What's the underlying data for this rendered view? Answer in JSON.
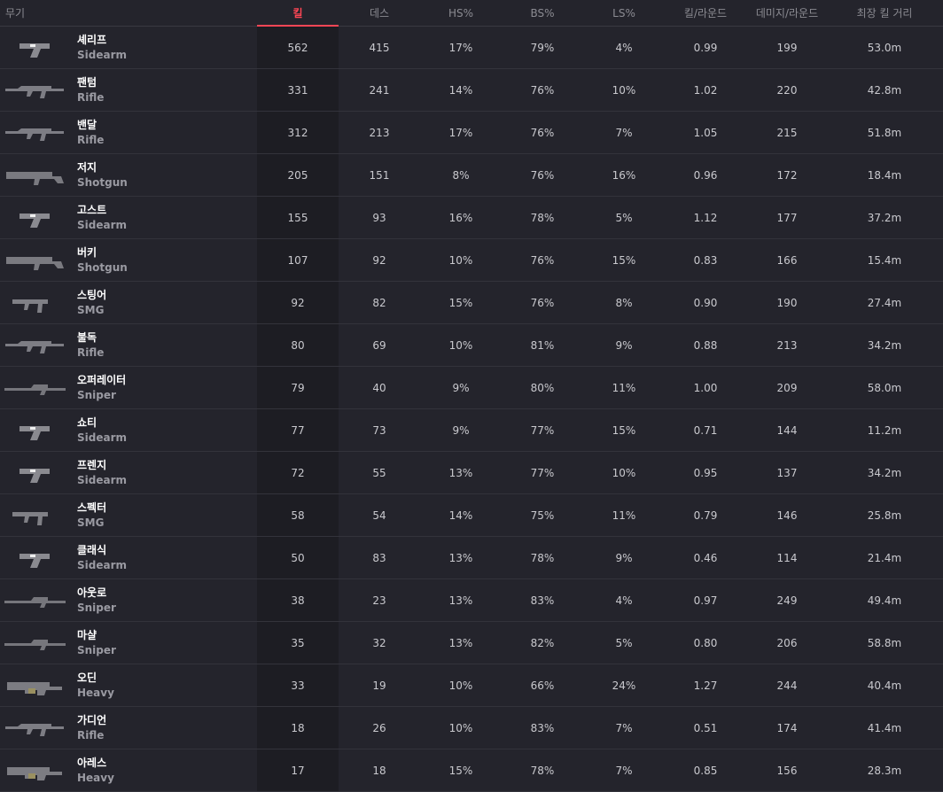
{
  "headers": {
    "weapon": "무기",
    "kills": "킬",
    "deaths": "데스",
    "hs": "HS%",
    "bs": "BS%",
    "ls": "LS%",
    "kpr": "킬/라운드",
    "dpr": "데미지/라운드",
    "longest": "최장 킬 거리"
  },
  "colors": {
    "accent": "#ff4655",
    "background": "#24242c",
    "sorted_column": "#1d1d23"
  },
  "rows": [
    {
      "icon": "sheriff-icon",
      "name": "셰리프",
      "type": "Sidearm",
      "kills": "562",
      "deaths": "415",
      "hs": "17%",
      "bs": "79%",
      "ls": "4%",
      "kpr": "0.99",
      "dpr": "199",
      "longest": "53.0m"
    },
    {
      "icon": "phantom-icon",
      "name": "팬텀",
      "type": "Rifle",
      "kills": "331",
      "deaths": "241",
      "hs": "14%",
      "bs": "76%",
      "ls": "10%",
      "kpr": "1.02",
      "dpr": "220",
      "longest": "42.8m"
    },
    {
      "icon": "vandal-icon",
      "name": "밴달",
      "type": "Rifle",
      "kills": "312",
      "deaths": "213",
      "hs": "17%",
      "bs": "76%",
      "ls": "7%",
      "kpr": "1.05",
      "dpr": "215",
      "longest": "51.8m"
    },
    {
      "icon": "judge-icon",
      "name": "저지",
      "type": "Shotgun",
      "kills": "205",
      "deaths": "151",
      "hs": "8%",
      "bs": "76%",
      "ls": "16%",
      "kpr": "0.96",
      "dpr": "172",
      "longest": "18.4m"
    },
    {
      "icon": "ghost-icon",
      "name": "고스트",
      "type": "Sidearm",
      "kills": "155",
      "deaths": "93",
      "hs": "16%",
      "bs": "78%",
      "ls": "5%",
      "kpr": "1.12",
      "dpr": "177",
      "longest": "37.2m"
    },
    {
      "icon": "bucky-icon",
      "name": "버키",
      "type": "Shotgun",
      "kills": "107",
      "deaths": "92",
      "hs": "10%",
      "bs": "76%",
      "ls": "15%",
      "kpr": "0.83",
      "dpr": "166",
      "longest": "15.4m"
    },
    {
      "icon": "stinger-icon",
      "name": "스팅어",
      "type": "SMG",
      "kills": "92",
      "deaths": "82",
      "hs": "15%",
      "bs": "76%",
      "ls": "8%",
      "kpr": "0.90",
      "dpr": "190",
      "longest": "27.4m"
    },
    {
      "icon": "bulldog-icon",
      "name": "불독",
      "type": "Rifle",
      "kills": "80",
      "deaths": "69",
      "hs": "10%",
      "bs": "81%",
      "ls": "9%",
      "kpr": "0.88",
      "dpr": "213",
      "longest": "34.2m"
    },
    {
      "icon": "operator-icon",
      "name": "오퍼레이터",
      "type": "Sniper",
      "kills": "79",
      "deaths": "40",
      "hs": "9%",
      "bs": "80%",
      "ls": "11%",
      "kpr": "1.00",
      "dpr": "209",
      "longest": "58.0m"
    },
    {
      "icon": "shorty-icon",
      "name": "쇼티",
      "type": "Sidearm",
      "kills": "77",
      "deaths": "73",
      "hs": "9%",
      "bs": "77%",
      "ls": "15%",
      "kpr": "0.71",
      "dpr": "144",
      "longest": "11.2m"
    },
    {
      "icon": "frenzy-icon",
      "name": "프렌지",
      "type": "Sidearm",
      "kills": "72",
      "deaths": "55",
      "hs": "13%",
      "bs": "77%",
      "ls": "10%",
      "kpr": "0.95",
      "dpr": "137",
      "longest": "34.2m"
    },
    {
      "icon": "spectre-icon",
      "name": "스펙터",
      "type": "SMG",
      "kills": "58",
      "deaths": "54",
      "hs": "14%",
      "bs": "75%",
      "ls": "11%",
      "kpr": "0.79",
      "dpr": "146",
      "longest": "25.8m"
    },
    {
      "icon": "classic-icon",
      "name": "클래식",
      "type": "Sidearm",
      "kills": "50",
      "deaths": "83",
      "hs": "13%",
      "bs": "78%",
      "ls": "9%",
      "kpr": "0.46",
      "dpr": "114",
      "longest": "21.4m"
    },
    {
      "icon": "outlaw-icon",
      "name": "아웃로",
      "type": "Sniper",
      "kills": "38",
      "deaths": "23",
      "hs": "13%",
      "bs": "83%",
      "ls": "4%",
      "kpr": "0.97",
      "dpr": "249",
      "longest": "49.4m"
    },
    {
      "icon": "marshal-icon",
      "name": "마샬",
      "type": "Sniper",
      "kills": "35",
      "deaths": "32",
      "hs": "13%",
      "bs": "82%",
      "ls": "5%",
      "kpr": "0.80",
      "dpr": "206",
      "longest": "58.8m"
    },
    {
      "icon": "odin-icon",
      "name": "오딘",
      "type": "Heavy",
      "kills": "33",
      "deaths": "19",
      "hs": "10%",
      "bs": "66%",
      "ls": "24%",
      "kpr": "1.27",
      "dpr": "244",
      "longest": "40.4m"
    },
    {
      "icon": "guardian-icon",
      "name": "가디언",
      "type": "Rifle",
      "kills": "18",
      "deaths": "26",
      "hs": "10%",
      "bs": "83%",
      "ls": "7%",
      "kpr": "0.51",
      "dpr": "174",
      "longest": "41.4m"
    },
    {
      "icon": "ares-icon",
      "name": "아레스",
      "type": "Heavy",
      "kills": "17",
      "deaths": "18",
      "hs": "15%",
      "bs": "78%",
      "ls": "7%",
      "kpr": "0.85",
      "dpr": "156",
      "longest": "28.3m"
    }
  ]
}
